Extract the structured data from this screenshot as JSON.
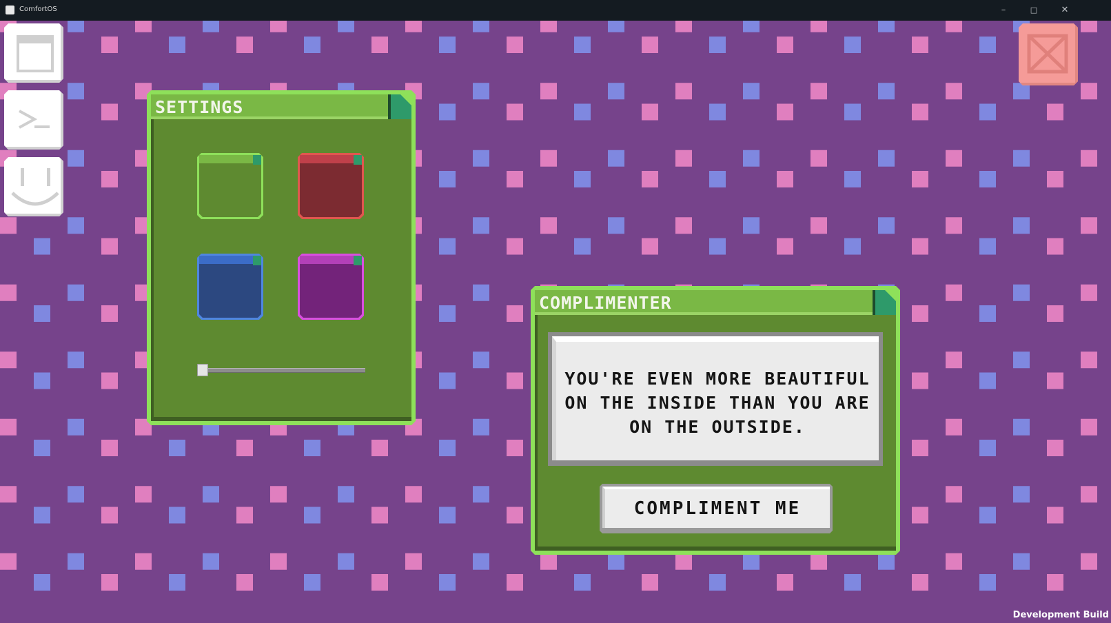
{
  "window": {
    "title": "ComfortOS"
  },
  "theme_colors": {
    "background": "#76438b",
    "dot_pink": "#e07fbf",
    "dot_blue": "#7f88e0",
    "window_frame": "#8ee05a",
    "window_body": "#5e8a30"
  },
  "dock": {
    "items": [
      {
        "icon": "window-icon"
      },
      {
        "icon": "terminal-icon"
      },
      {
        "icon": "smiley-icon"
      }
    ],
    "exit_icon": "close-icon"
  },
  "settings_window": {
    "title": "SETTINGS",
    "themes": [
      {
        "name": "green",
        "frame": "#8ee05a",
        "fill": "#5e8a30",
        "bar": "#7ab845"
      },
      {
        "name": "red",
        "frame": "#e0574f",
        "fill": "#7c2b31",
        "bar": "#c0404a"
      },
      {
        "name": "blue",
        "frame": "#4f86e0",
        "fill": "#2c4880",
        "bar": "#3b6cc8"
      },
      {
        "name": "purple",
        "frame": "#d94fe0",
        "fill": "#73237a",
        "bar": "#b340b8"
      }
    ],
    "volume": 0.0
  },
  "complimenter_window": {
    "title": "COMPLIMENTER",
    "compliment": "YOU'RE EVEN MORE BEAUTIFUL ON THE INSIDE THAN YOU ARE ON THE OUTSIDE.",
    "button_label": "COMPLIMENT ME"
  },
  "build_label": "Development Build"
}
